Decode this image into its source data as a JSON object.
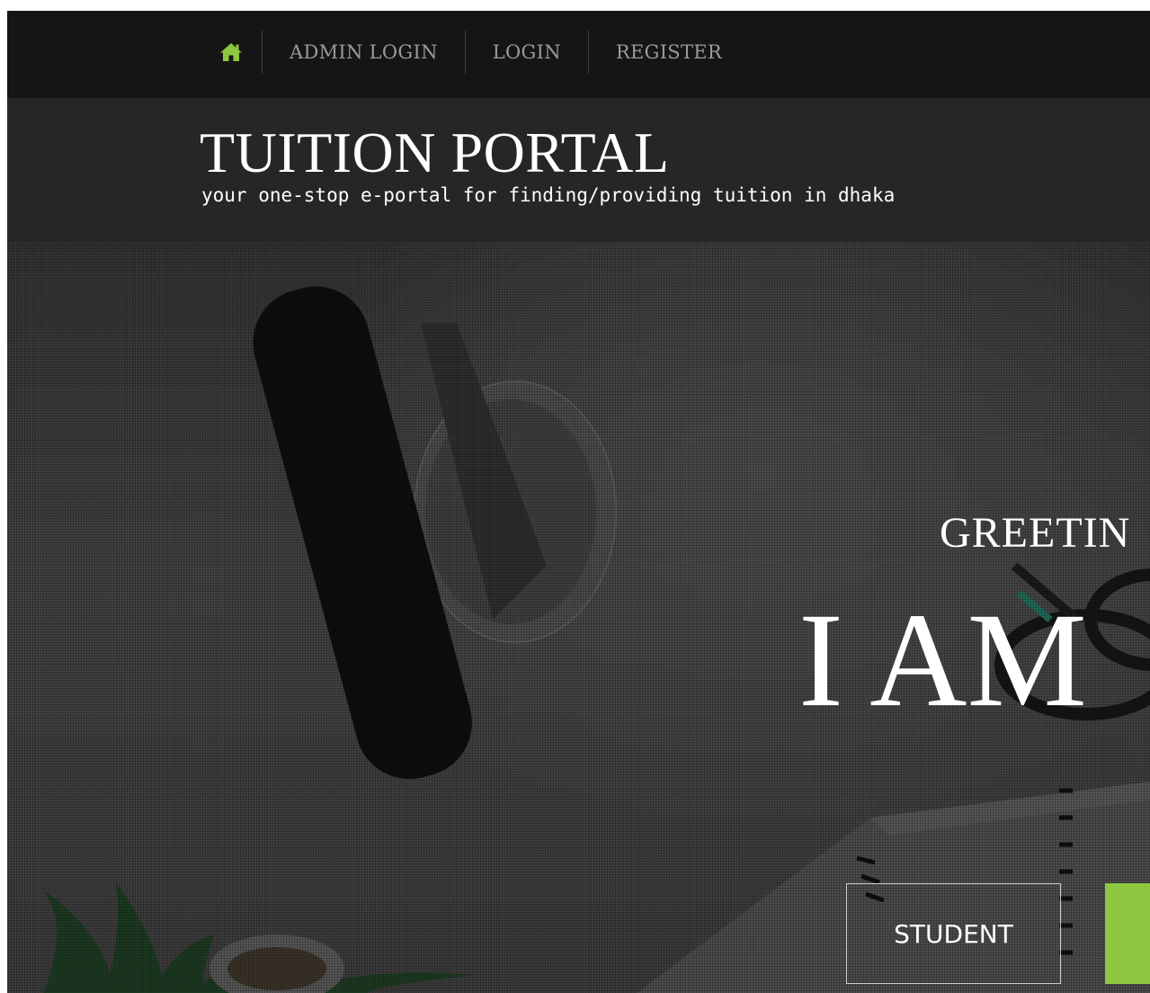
{
  "nav": {
    "home_icon": "home-icon",
    "items": [
      {
        "label": "ADMIN LOGIN"
      },
      {
        "label": "LOGIN"
      },
      {
        "label": "REGISTER"
      }
    ]
  },
  "header": {
    "title": "TUITION PORTAL",
    "tagline": "your one-stop e-portal for finding/providing tuition in dhaka"
  },
  "hero": {
    "greeting": "GREETIN",
    "headline": "I AM",
    "student_button": "STUDENT",
    "tutor_button": ""
  },
  "colors": {
    "accent": "#8dc63f",
    "nav_bg": "#151515",
    "header_bg": "#262626",
    "nav_text": "#9a9a9a"
  }
}
